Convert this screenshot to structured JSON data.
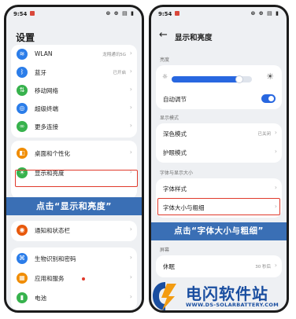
{
  "left_phone": {
    "status": {
      "time": "9:54",
      "right": "⊗ ⊕ ▤ ▮"
    },
    "title": "设置",
    "group1": [
      {
        "label": "WLAN",
        "value": "龙翔通讯5G",
        "icon": "wifi-icon",
        "color": "#2b7de9",
        "glyph": "≋"
      },
      {
        "label": "蓝牙",
        "value": "已开启",
        "icon": "bluetooth-icon",
        "color": "#2b7de9",
        "glyph": "ᛒ"
      },
      {
        "label": "移动网络",
        "value": "",
        "icon": "mobile-network-icon",
        "color": "#37b24d",
        "glyph": "⇅"
      },
      {
        "label": "超级终端",
        "value": "",
        "icon": "super-device-icon",
        "color": "#2b7de9",
        "glyph": "◎"
      },
      {
        "label": "更多连接",
        "value": "",
        "icon": "more-connections-icon",
        "color": "#37b24d",
        "glyph": "∞"
      }
    ],
    "group2": [
      {
        "label": "桌面和个性化",
        "icon": "desktop-icon",
        "color": "#f08c00",
        "glyph": "◧"
      },
      {
        "label": "显示和亮度",
        "icon": "display-icon",
        "color": "#37b24d",
        "glyph": "☀"
      }
    ],
    "group3": [
      {
        "label": "通知和状态栏",
        "icon": "notification-icon",
        "color": "#e8590c",
        "glyph": "◉"
      }
    ],
    "group4": [
      {
        "label": "生物识别和密码",
        "icon": "biometric-icon",
        "color": "#2b7de9",
        "glyph": "⌘"
      },
      {
        "label": "应用和服务",
        "icon": "apps-icon",
        "color": "#f08c00",
        "glyph": "▦"
      },
      {
        "label": "电池",
        "icon": "battery-icon",
        "color": "#37b24d",
        "glyph": "▮"
      }
    ],
    "banner": "点击“显示和亮度”"
  },
  "right_phone": {
    "status": {
      "time": "9:54",
      "right": "⊗ ⊕ ▤ ▮"
    },
    "title": "显示和亮度",
    "brightness_label": "亮度",
    "brightness_level": 0.85,
    "auto_adjust_label": "自动调节",
    "auto_adjust_on": true,
    "display_mode_label": "显示模式",
    "dark_mode": {
      "label": "深色模式",
      "value": "已关闭"
    },
    "eye_care": {
      "label": "护眼模式"
    },
    "font_section_label": "字体与显示大小",
    "font_style": {
      "label": "字体样式"
    },
    "font_size": {
      "label": "字体大小与粗细"
    },
    "screen_label": "屏幕",
    "sleep": {
      "label": "休眠",
      "value": "30 秒后"
    },
    "banner": "点击“字体大小与粗细”"
  },
  "watermark": {
    "name": "电闪软件站",
    "url": "WWW.DS-SOLARBATTERY.COM",
    "colors": {
      "blue": "#1a4ea0",
      "orange": "#f39c12"
    }
  }
}
